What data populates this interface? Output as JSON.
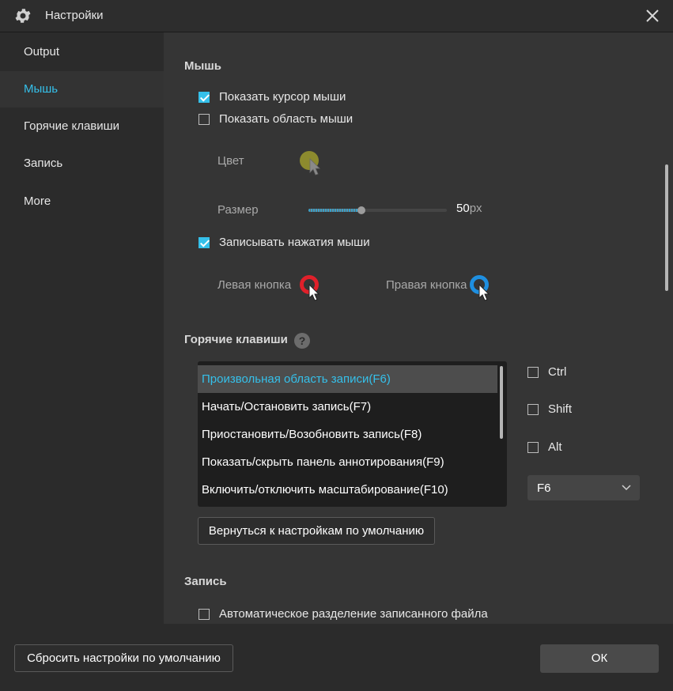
{
  "window": {
    "title": "Настройки",
    "icon": "gear-icon",
    "close_icon": "close-icon"
  },
  "sidebar": {
    "items": [
      {
        "label": "Output",
        "active": false
      },
      {
        "label": "Мышь",
        "active": true
      },
      {
        "label": "Горячие клавиши",
        "active": false
      },
      {
        "label": "Запись",
        "active": false
      },
      {
        "label": "More",
        "active": false
      }
    ]
  },
  "mouse": {
    "section_title": "Мышь",
    "show_cursor": {
      "label": "Показать курсор мыши",
      "checked": true
    },
    "show_area": {
      "label": "Показать область мыши",
      "checked": false
    },
    "color_label": "Цвет",
    "color_value": "#8c8a2e",
    "size_label": "Размер",
    "size_value": "50",
    "size_unit": "px",
    "size_fraction": 0.38,
    "record_clicks": {
      "label": "Записывать нажатия мыши",
      "checked": true
    },
    "left_button_label": "Левая кнопка",
    "left_button_color": "#e0202a",
    "right_button_label": "Правая кнопка",
    "right_button_color": "#1e8fe0"
  },
  "hotkeys": {
    "section_title": "Горячие клавиши",
    "help_icon": "help-icon",
    "items": [
      {
        "label": "Произвольная область записи(F6)",
        "selected": true
      },
      {
        "label": "Начать/Остановить запись(F7)",
        "selected": false
      },
      {
        "label": "Приостановить/Возобновить запись(F8)",
        "selected": false
      },
      {
        "label": "Показать/скрыть панель аннотирования(F9)",
        "selected": false
      },
      {
        "label": "Включить/отключить масштабирование(F10)",
        "selected": false
      }
    ],
    "modifiers": [
      {
        "label": "Ctrl",
        "checked": false
      },
      {
        "label": "Shift",
        "checked": false
      },
      {
        "label": "Alt",
        "checked": false
      }
    ],
    "key_value": "F6",
    "reset_label": "Вернуться к настройкам по умолчанию"
  },
  "record": {
    "section_title": "Запись",
    "auto_split": {
      "label": "Автоматическое разделение записанного файла",
      "checked": false
    }
  },
  "footer": {
    "reset_all_label": "Сбросить настройки по умолчанию",
    "ok_label": "ОК"
  },
  "colors": {
    "accent": "#35c0ea"
  }
}
